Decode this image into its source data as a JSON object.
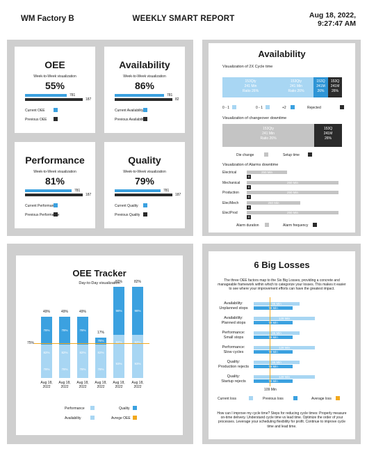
{
  "header": {
    "factory": "WM Factory B",
    "title": "WEEKLY SMART REPORT",
    "date": "Aug 18, 2022,",
    "time": "9:27:47 AM"
  },
  "metrics": [
    {
      "name": "OEE",
      "sub": "Week-to-Week visualization",
      "pct": "55%",
      "current_value": "781",
      "previous_value": "187",
      "current_ratio": 0.72,
      "previous_ratio": 1.0,
      "current_label": "Current OEE",
      "previous_label": "Previous OEE"
    },
    {
      "name": "Availability",
      "sub": "Week-to-Week visualization",
      "pct": "86%",
      "current_value": "781",
      "previous_value": "82",
      "current_ratio": 0.86,
      "previous_ratio": 1.0,
      "current_label": "Current Availability",
      "previous_label": "Previous Availability"
    },
    {
      "name": "Performance",
      "sub": "Week-to-Week visualization",
      "pct": "81%",
      "current_value": "781",
      "previous_value": "187",
      "current_ratio": 0.81,
      "previous_ratio": 1.0,
      "current_label": "Current Performance",
      "previous_label": "Previous Performance"
    },
    {
      "name": "Quality",
      "sub": "Week-to-Week visualization",
      "pct": "79%",
      "current_value": "781",
      "previous_value": "187",
      "current_ratio": 0.79,
      "previous_ratio": 1.0,
      "current_label": "Current Quality",
      "previous_label": "Previous Quality"
    }
  ],
  "availability": {
    "title": "Availability",
    "cycle_title": "Visualization of 2X Cycle time",
    "cycle_segments": [
      {
        "l1": "153Qty",
        "l2": "241 Min",
        "l3": "Ratio 26%"
      },
      {
        "l1": "153Qty",
        "l2": "241 Min",
        "l3": "Ratio 26%"
      },
      {
        "l1": "153Q",
        "l2": "241M",
        "l3": "26%"
      },
      {
        "l1": "153Q",
        "l2": "241M",
        "l3": "26%"
      }
    ],
    "cycle_legend": [
      "0 - 1",
      "0 - 1",
      "+2",
      "Rejected"
    ],
    "changeover_title": "Visualization of changeover downtime",
    "changeover_segments": [
      {
        "l1": "153Qty",
        "l2": "241 Min",
        "l3": "Ratio 26%"
      },
      {
        "l1": "153Q",
        "l2": "241M",
        "l3": "26%"
      }
    ],
    "changeover_legend": [
      "Die change",
      "Setup time"
    ],
    "alarms_title": "Visualization of Alarms downtime",
    "alarms": [
      {
        "label": "Electrical",
        "text": "250 Min",
        "len": 0.43,
        "freq": "8"
      },
      {
        "label": "Mechanical",
        "text": "250 Min",
        "len": 0.98,
        "freq": "8"
      },
      {
        "label": "Production",
        "text": "250 Min",
        "len": 0.98,
        "freq": "8"
      },
      {
        "label": "Elec/Mech",
        "text": "250 Min",
        "len": 0.57,
        "freq": "8"
      },
      {
        "label": "Elec/Prod",
        "text": "250 Min",
        "len": 0.98,
        "freq": "8"
      }
    ],
    "alarms_legend": [
      "Alarm duration",
      "Alarm frequency"
    ]
  },
  "tracker": {
    "title": "OEE Tracker",
    "sub": "Day-to-Day visualization",
    "target_label": "75%",
    "legend": [
      "Performance",
      "Quality",
      "Availability",
      "Avrege OEE"
    ],
    "chart_data": {
      "type": "bar",
      "categories": [
        "Aug 18, 2022",
        "Aug 18, 2022",
        "Aug 18, 2022",
        "Aug 18, 2022",
        "Aug 18, 2022",
        "Aug 18, 2022"
      ],
      "series": [
        {
          "name": "Availability",
          "values": [
            78,
            78,
            78,
            78,
            93,
            93
          ]
        },
        {
          "name": "Performance",
          "values": [
            82,
            82,
            82,
            82,
            82,
            82
          ]
        },
        {
          "name": "Quality",
          "values": [
            78,
            78,
            78,
            78,
            98,
            98
          ]
        }
      ],
      "oee_values": [
        "49%",
        "49%",
        "49%",
        "17%",
        "82%",
        "82%"
      ],
      "average_oee": 75
    }
  },
  "losses": {
    "title": "6 Big Losses",
    "intro": "The three OEE factors map to the Six Big Losses, providing a concrete and manageable framework within which to categorize your losses. This makes it easier to see where your improvement efforts can have the greatest impact.",
    "rows": [
      {
        "label": "Availability: Unplanned stops",
        "current": "96 Min",
        "previous": "78 Min"
      },
      {
        "label": "Availability: Planned stops",
        "current": "128 Min",
        "previous": "78 Min"
      },
      {
        "label": "Performance: Small stops",
        "current": "96 Min",
        "previous": "78 Min"
      },
      {
        "label": "Performance: Slow cycles",
        "current": "128 Min",
        "previous": "78 Min"
      },
      {
        "label": "Quality: Production rejects",
        "current": "96 Min",
        "previous": "78 Min"
      },
      {
        "label": "Quality: Startup rejects",
        "current": "128 Min",
        "previous": "78 Min"
      }
    ],
    "axis_label": "109 Min",
    "legend": [
      "Current loss",
      "Previous loss",
      "Average loss"
    ],
    "outro": "How can I improve my cycle time? Steps for reducing cycle times: Properly measure on-time delivery. Understand cycle time vs lead time. Optimize the order of your processes. Leverage your scheduling flexibility for profit. Continue to improve cycle time and lead time."
  },
  "colors": {
    "blue": "#3ba1e0",
    "dark": "#2b2b2b",
    "light_blue": "#a8d6f3",
    "gray": "#c4c4c4",
    "orange": "#f2a81d",
    "panel": "#cfcfcf"
  }
}
